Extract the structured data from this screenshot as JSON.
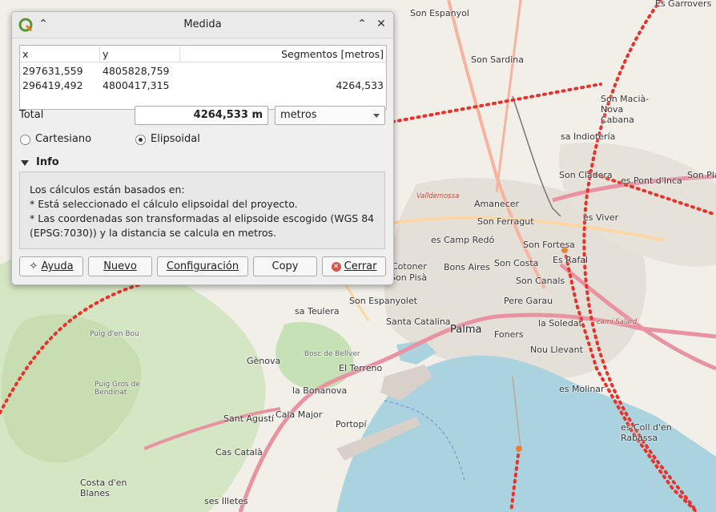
{
  "window": {
    "title": "Medida"
  },
  "table": {
    "headers": [
      "x",
      "y",
      "Segmentos [metros]"
    ],
    "rows": [
      [
        "297631,559",
        "4805828,759",
        ""
      ],
      [
        "296419,492",
        "4800417,315",
        "4264,533"
      ]
    ]
  },
  "total": {
    "label": "Total",
    "value": "4264,533 m",
    "units": "metros"
  },
  "radios": {
    "cartesian": "Cartesiano",
    "ellipsoidal": "Elipsoidal",
    "selected": "ellipsoidal"
  },
  "info": {
    "header": "Info",
    "lines": [
      "Los cálculos están basados en:",
      "* Está seleccionado el cálculo elipsoidal del proyecto.",
      "* Las coordenadas son transformadas al elipsoide escogido (WGS 84",
      "(EPSG:7030)) y la distancia se calcula en metros."
    ]
  },
  "buttons": {
    "help": "Ayuda",
    "new": "Nuevo",
    "config": "Configuración",
    "copy": "Copy",
    "close": "Cerrar"
  },
  "map": {
    "labels": [
      "Son Espanyol",
      "Es Garrovers",
      "Son Sardina",
      "Son Macià-Nova Cabana",
      "sa Indiotería",
      "Amanecer",
      "Son Ferragut",
      "Son Cladera",
      "es Pont d'Inca",
      "es Viver",
      "es Camp Redó",
      "es Camp Redó",
      "Son Fortesa",
      "Es Rafal",
      "Bons Aires",
      "Son Costa",
      "Son Canals",
      "Son Espanyolet",
      "sa Teulera",
      "Pere Garau",
      "Santa Catalina",
      "Palma",
      "la Soledat",
      "Foners",
      "Nou Llevant",
      "Gènova",
      "El Terreno",
      "la Bonanova",
      "Sant Agustí",
      "Cala Major",
      "Portopí",
      "es Molinar",
      "es Coll d'en Rabassa",
      "Cas Català",
      "Costa d'en Blanes",
      "ses Illetes",
      "Son Pisà",
      "Cotoner",
      "Puig d'en Bou",
      "Puig Gros de Bendinat",
      "Bosc de Bellver",
      "Valldemossa",
      "cami Salard",
      "Son Pla de",
      "Son Pla"
    ]
  }
}
